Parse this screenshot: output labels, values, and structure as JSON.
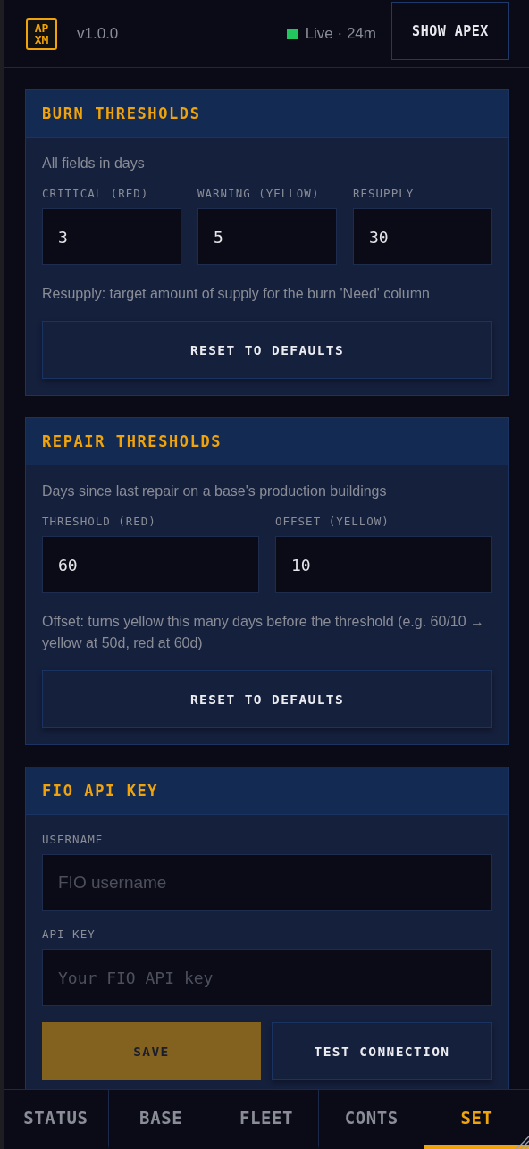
{
  "header": {
    "logo": [
      "AP",
      "XM"
    ],
    "version": "v1.0.0",
    "status": {
      "live": true,
      "text": "Live · 24m"
    },
    "button": "SHOW APEX"
  },
  "sections": [
    {
      "title": "BURN THRESHOLDS",
      "hint": "All fields in days",
      "fields": [
        {
          "label": "CRITICAL (RED)",
          "kind": "number",
          "value": "3"
        },
        {
          "label": "WARNING (YELLOW)",
          "kind": "number",
          "value": "5"
        },
        {
          "label": "RESUPPLY",
          "kind": "number",
          "value": "30"
        }
      ],
      "note": "Resupply: target amount of supply for the burn 'Need' column",
      "buttons": [
        {
          "label": "RESET TO DEFAULTS",
          "kind": "secondary"
        }
      ]
    },
    {
      "title": "REPAIR THRESHOLDS",
      "hint": "Days since last repair on a base's production buildings",
      "fields": [
        {
          "label": "THRESHOLD (RED)",
          "kind": "number",
          "value": "60"
        },
        {
          "label": "OFFSET (YELLOW)",
          "kind": "number",
          "value": "10"
        }
      ],
      "note": "Offset: turns yellow this many days before the threshold (e.g. 60/10 → yellow at 50d, red at 60d)",
      "buttons": [
        {
          "label": "RESET TO DEFAULTS",
          "kind": "secondary"
        }
      ]
    },
    {
      "title": "FIO API KEY",
      "fields": [
        {
          "label": "USERNAME",
          "kind": "text",
          "placeholder": "FIO username"
        },
        {
          "label": "API KEY",
          "kind": "secret",
          "placeholder": "Your FIO API key"
        }
      ],
      "buttons": [
        {
          "label": "SAVE",
          "kind": "primary"
        },
        {
          "label": "TEST CONNECTION",
          "kind": "secondary"
        }
      ]
    }
  ],
  "tabs": [
    {
      "label": "STATUS",
      "selected": false
    },
    {
      "label": "BASE",
      "selected": false
    },
    {
      "label": "FLEET",
      "selected": false
    },
    {
      "label": "CONTS",
      "selected": false
    },
    {
      "label": "SET",
      "selected": true
    }
  ]
}
